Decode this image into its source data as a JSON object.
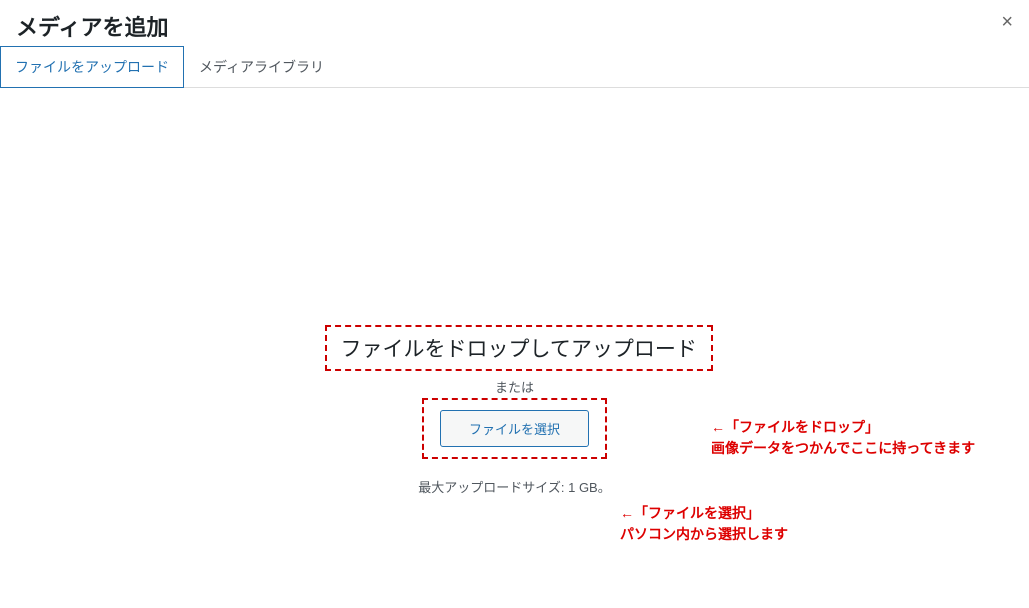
{
  "header": {
    "title": "メディアを追加"
  },
  "tabs": {
    "upload": "ファイルをアップロード",
    "library": "メディアライブラリ"
  },
  "uploader": {
    "drop_text": "ファイルをドロップしてアップロード",
    "or_text": "または",
    "select_button": "ファイルを選択",
    "max_size": "最大アップロードサイズ: 1 GB。"
  },
  "annotations": {
    "drop": {
      "arrow": "←",
      "title": "「ファイルをドロップ」",
      "desc": "画像データをつかんでここに持ってきます"
    },
    "select": {
      "arrow": "←",
      "title": "「ファイルを選択」",
      "desc": "パソコン内から選択します"
    }
  }
}
